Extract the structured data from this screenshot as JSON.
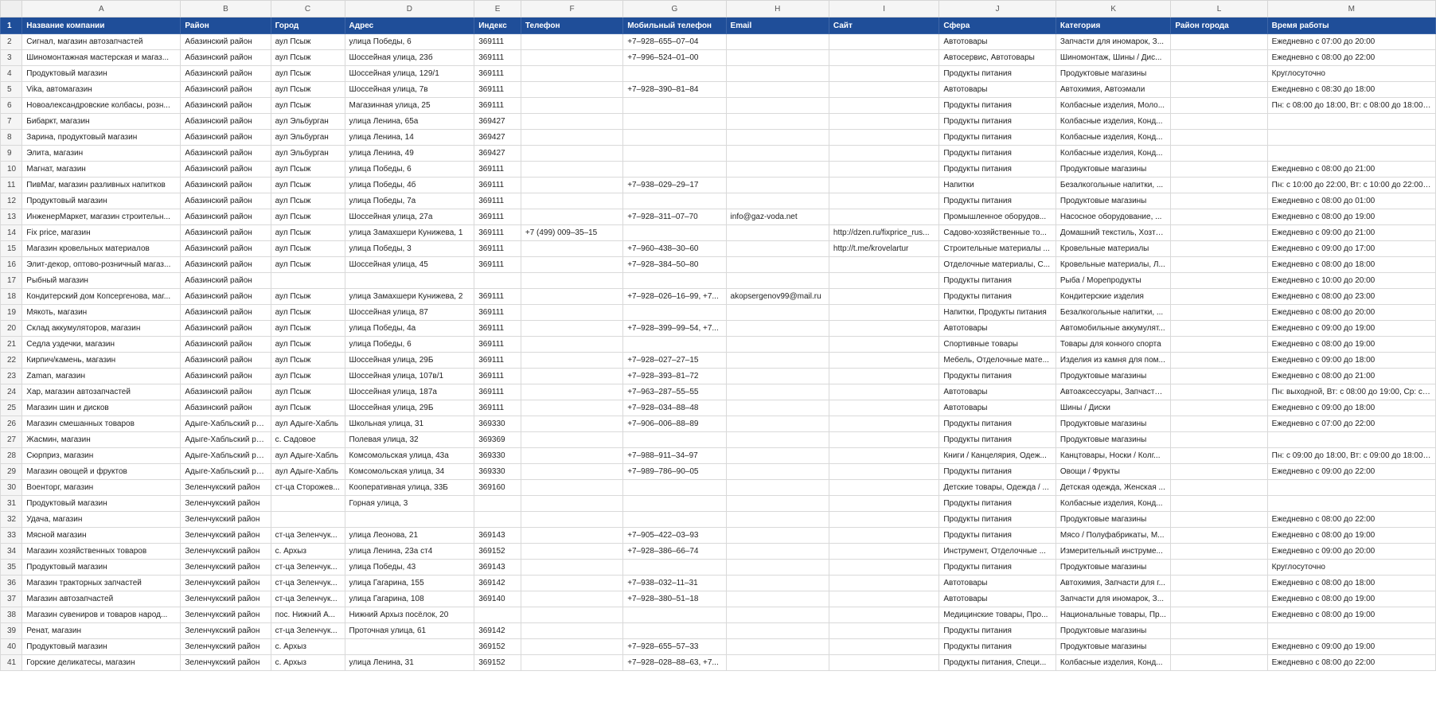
{
  "columns": [
    "A",
    "B",
    "C",
    "D",
    "E",
    "F",
    "G",
    "H",
    "I",
    "J",
    "K",
    "L",
    "M"
  ],
  "header_row_number": "1",
  "headers": [
    "Название компании",
    "Район",
    "Город",
    "Адрес",
    "Индекс",
    "Телефон",
    "Мобильный телефон",
    "Email",
    "Сайт",
    "Сфера",
    "Категория",
    "Район города",
    "Время работы"
  ],
  "rows": [
    {
      "n": "2",
      "c": [
        "Сигнал, магазин автозапчастей",
        "Абазинский район",
        "аул Псыж",
        "улица Победы, 6",
        "369111",
        "",
        "+7‒928‒655‒07‒04",
        "",
        "",
        "Автотовары",
        "Запчасти для иномарок, З...",
        "",
        "Ежедневно с 07:00 до 20:00"
      ]
    },
    {
      "n": "3",
      "c": [
        "Шиномонтажная мастерская и магаз...",
        "Абазинский район",
        "аул Псыж",
        "Шоссейная улица, 23б",
        "369111",
        "",
        "+7‒996‒524‒01‒00",
        "",
        "",
        "Автосервис, Автотовары",
        "Шиномонтаж, Шины / Дис...",
        "",
        "Ежедневно с 08:00 до 22:00"
      ]
    },
    {
      "n": "4",
      "c": [
        "Продуктовый магазин",
        "Абазинский район",
        "аул Псыж",
        "Шоссейная улица, 129/1",
        "369111",
        "",
        "",
        "",
        "",
        "Продукты питания",
        "Продуктовые магазины",
        "",
        "Круглосуточно"
      ]
    },
    {
      "n": "5",
      "c": [
        "Vika, автомагазин",
        "Абазинский район",
        "аул Псыж",
        "Шоссейная улица, 7в",
        "369111",
        "",
        "+7‒928‒390‒81‒84",
        "",
        "",
        "Автотовары",
        "Автохимия, Автоэмали",
        "",
        "Ежедневно с 08:30 до 18:00"
      ]
    },
    {
      "n": "6",
      "c": [
        "Новоалександровские колбасы, розн...",
        "Абазинский район",
        "аул Псыж",
        "Магазинная улица, 25",
        "369111",
        "",
        "",
        "",
        "",
        "Продукты питания",
        "Колбасные изделия, Моло...",
        "",
        "Пн: с 08:00 до 18:00, Вт: с 08:00 до 18:00, С..."
      ]
    },
    {
      "n": "7",
      "c": [
        "Бибаркт, магазин",
        "Абазинский район",
        "аул Эльбурган",
        "улица Ленина, 65а",
        "369427",
        "",
        "",
        "",
        "",
        "Продукты питания",
        "Колбасные изделия, Конд...",
        "",
        ""
      ]
    },
    {
      "n": "8",
      "c": [
        "Зарина, продуктовый магазин",
        "Абазинский район",
        "аул Эльбурган",
        "улица Ленина, 14",
        "369427",
        "",
        "",
        "",
        "",
        "Продукты питания",
        "Колбасные изделия, Конд...",
        "",
        ""
      ]
    },
    {
      "n": "9",
      "c": [
        "Элита, магазин",
        "Абазинский район",
        "аул Эльбурган",
        "улица Ленина, 49",
        "369427",
        "",
        "",
        "",
        "",
        "Продукты питания",
        "Колбасные изделия, Конд...",
        "",
        ""
      ]
    },
    {
      "n": "10",
      "c": [
        "Магнат, магазин",
        "Абазинский район",
        "аул Псыж",
        "улица Победы, 6",
        "369111",
        "",
        "",
        "",
        "",
        "Продукты питания",
        "Продуктовые магазины",
        "",
        "Ежедневно с 08:00 до 21:00"
      ]
    },
    {
      "n": "11",
      "c": [
        "ПивМаг, магазин разливных напитков",
        "Абазинский район",
        "аул Псыж",
        "улица Победы, 4б",
        "369111",
        "",
        "+7‒938‒029‒29‒17",
        "",
        "",
        "Напитки",
        "Безалкогольные напитки, ...",
        "",
        "Пн: с 10:00 до 22:00, Вт: с 10:00 до 22:00, С..."
      ]
    },
    {
      "n": "12",
      "c": [
        "Продуктовый магазин",
        "Абазинский район",
        "аул Псыж",
        "улица Победы, 7а",
        "369111",
        "",
        "",
        "",
        "",
        "Продукты питания",
        "Продуктовые магазины",
        "",
        "Ежедневно с 08:00 до 01:00"
      ]
    },
    {
      "n": "13",
      "c": [
        "ИнженерМаркет, магазин строительн...",
        "Абазинский район",
        "аул Псыж",
        "Шоссейная улица, 27а",
        "369111",
        "",
        "+7‒928‒311‒07‒70",
        "info@gaz-voda.net",
        "",
        "Промышленное оборудов...",
        "Насосное оборудование, ...",
        "",
        "Ежедневно с 08:00 до 19:00"
      ]
    },
    {
      "n": "14",
      "c": [
        "Fix price, магазин",
        "Абазинский район",
        "аул Псыж",
        "улица Замахшери Кунижева, 1",
        "369111",
        "+7 (499) 009‒35‒15",
        "",
        "",
        "http://dzen.ru/fixprice_rus...",
        "Садово-хозяйственные то...",
        "Домашний текстиль, Хозто...",
        "",
        "Ежедневно с 09:00 до 21:00"
      ]
    },
    {
      "n": "15",
      "c": [
        "Магазин кровельных материалов",
        "Абазинский район",
        "аул Псыж",
        "улица Победы, 3",
        "369111",
        "",
        "+7‒960‒438‒30‒60",
        "",
        "http://t.me/krovelartur",
        "Строительные материалы ...",
        "Кровельные материалы",
        "",
        "Ежедневно с 09:00 до 17:00"
      ]
    },
    {
      "n": "16",
      "c": [
        "Элит-декор, оптово-розничный магаз...",
        "Абазинский район",
        "аул Псыж",
        "Шоссейная улица, 45",
        "369111",
        "",
        "+7‒928‒384‒50‒80",
        "",
        "",
        "Отделочные материалы, С...",
        "Кровельные материалы, Л...",
        "",
        "Ежедневно с 08:00 до 18:00"
      ]
    },
    {
      "n": "17",
      "c": [
        "Рыбный магазин",
        "Абазинский район",
        "",
        "",
        "",
        "",
        "",
        "",
        "",
        "Продукты питания",
        "Рыба / Морепродукты",
        "",
        "Ежедневно с 10:00 до 20:00"
      ]
    },
    {
      "n": "18",
      "c": [
        "Кондитерский дом Копсергенова, маг...",
        "Абазинский район",
        "аул Псыж",
        "улица Замахшери Кунижева, 2",
        "369111",
        "",
        "+7‒928‒026‒16‒99, +7...",
        "akopsergenov99@mail.ru",
        "",
        "Продукты питания",
        "Кондитерские изделия",
        "",
        "Ежедневно с 08:00 до 23:00"
      ]
    },
    {
      "n": "19",
      "c": [
        "Мякоть, магазин",
        "Абазинский район",
        "аул Псыж",
        "Шоссейная улица, 87",
        "369111",
        "",
        "",
        "",
        "",
        "Напитки, Продукты питания",
        "Безалкогольные напитки, ...",
        "",
        "Ежедневно с 08:00 до 20:00"
      ]
    },
    {
      "n": "20",
      "c": [
        "Склад аккумуляторов, магазин",
        "Абазинский район",
        "аул Псыж",
        "улица Победы, 4а",
        "369111",
        "",
        "+7‒928‒399‒99‒54, +7...",
        "",
        "",
        "Автотовары",
        "Автомобильные аккумулят...",
        "",
        "Ежедневно с 09:00 до 19:00"
      ]
    },
    {
      "n": "21",
      "c": [
        "Седла уздечки, магазин",
        "Абазинский район",
        "аул Псыж",
        "улица Победы, 6",
        "369111",
        "",
        "",
        "",
        "",
        "Спортивные товары",
        "Товары для конного спорта",
        "",
        "Ежедневно с 08:00 до 19:00"
      ]
    },
    {
      "n": "22",
      "c": [
        "Кирпич/камень, магазин",
        "Абазинский район",
        "аул Псыж",
        "Шоссейная улица, 29Б",
        "369111",
        "",
        "+7‒928‒027‒27‒15",
        "",
        "",
        "Мебель, Отделочные мате...",
        "Изделия из камня для пом...",
        "",
        "Ежедневно с 09:00 до 18:00"
      ]
    },
    {
      "n": "23",
      "c": [
        "Zaman, магазин",
        "Абазинский район",
        "аул Псыж",
        "Шоссейная улица, 107в/1",
        "369111",
        "",
        "+7‒928‒393‒81‒72",
        "",
        "",
        "Продукты питания",
        "Продуктовые магазины",
        "",
        "Ежедневно с 08:00 до 21:00"
      ]
    },
    {
      "n": "24",
      "c": [
        "Хар, магазин автозапчастей",
        "Абазинский район",
        "аул Псыж",
        "Шоссейная улица, 187а",
        "369111",
        "",
        "+7‒963‒287‒55‒55",
        "",
        "",
        "Автотовары",
        "Автоаксессуары, Запчасти ...",
        "",
        "Пн: выходной, Вт: с 08:00 до 19:00, Ср: с 0..."
      ]
    },
    {
      "n": "25",
      "c": [
        "Магазин шин и дисков",
        "Абазинский район",
        "аул Псыж",
        "Шоссейная улица, 29Б",
        "369111",
        "",
        "+7‒928‒034‒88‒48",
        "",
        "",
        "Автотовары",
        "Шины / Диски",
        "",
        "Ежедневно с 09:00 до 18:00"
      ]
    },
    {
      "n": "26",
      "c": [
        "Магазин смешанных товаров",
        "Адыге-Хабльский район",
        "аул Адыге-Хабль",
        "Школьная улица, 31",
        "369330",
        "",
        "+7‒906‒006‒88‒89",
        "",
        "",
        "Продукты питания",
        "Продуктовые магазины",
        "",
        "Ежедневно с 07:00 до 22:00"
      ]
    },
    {
      "n": "27",
      "c": [
        "Жасмин, магазин",
        "Адыге-Хабльский район",
        "с. Садовое",
        "Полевая улица, 32",
        "369369",
        "",
        "",
        "",
        "",
        "Продукты питания",
        "Продуктовые магазины",
        "",
        ""
      ]
    },
    {
      "n": "28",
      "c": [
        "Сюрприз, магазин",
        "Адыге-Хабльский район",
        "аул Адыге-Хабль",
        "Комсомольская улица, 43а",
        "369330",
        "",
        "+7‒988‒911‒34‒97",
        "",
        "",
        "Книги / Канцелярия, Одеж...",
        "Канцтовары, Носки / Колг...",
        "",
        "Пн: с 09:00 до 18:00, Вт: с 09:00 до 18:00, С..."
      ]
    },
    {
      "n": "29",
      "c": [
        "Магазин овощей и фруктов",
        "Адыге-Хабльский район",
        "аул Адыге-Хабль",
        "Комсомольская улица, 34",
        "369330",
        "",
        "+7‒989‒786‒90‒05",
        "",
        "",
        "Продукты питания",
        "Овощи / Фрукты",
        "",
        "Ежедневно с 09:00 до 22:00"
      ]
    },
    {
      "n": "30",
      "c": [
        "Военторг, магазин",
        "Зеленчукский район",
        "ст-ца Сторожев...",
        "Кооперативная улица, 33Б",
        "369160",
        "",
        "",
        "",
        "",
        "Детские товары, Одежда / ...",
        "Детская одежда, Женская ...",
        "",
        ""
      ]
    },
    {
      "n": "31",
      "c": [
        "Продуктовый магазин",
        "Зеленчукский район",
        "",
        "Горная улица, 3",
        "",
        "",
        "",
        "",
        "",
        "Продукты питания",
        "Колбасные изделия, Конд...",
        "",
        ""
      ]
    },
    {
      "n": "32",
      "c": [
        "Удача, магазин",
        "Зеленчукский район",
        "",
        "",
        "",
        "",
        "",
        "",
        "",
        "Продукты питания",
        "Продуктовые магазины",
        "",
        "Ежедневно с 08:00 до 22:00"
      ]
    },
    {
      "n": "33",
      "c": [
        "Мясной магазин",
        "Зеленчукский район",
        "ст-ца Зеленчук...",
        "улица Леонова, 21",
        "369143",
        "",
        "+7‒905‒422‒03‒93",
        "",
        "",
        "Продукты питания",
        "Мясо / Полуфабрикаты, М...",
        "",
        "Ежедневно с 08:00 до 19:00"
      ]
    },
    {
      "n": "34",
      "c": [
        "Магазин хозяйственных товаров",
        "Зеленчукский район",
        "с. Архыз",
        "улица Ленина, 23а ст4",
        "369152",
        "",
        "+7‒928‒386‒66‒74",
        "",
        "",
        "Инструмент, Отделочные ...",
        "Измерительный инструме...",
        "",
        "Ежедневно с 09:00 до 20:00"
      ]
    },
    {
      "n": "35",
      "c": [
        "Продуктовый магазин",
        "Зеленчукский район",
        "ст-ца Зеленчук...",
        "улица Победы, 43",
        "369143",
        "",
        "",
        "",
        "",
        "Продукты питания",
        "Продуктовые магазины",
        "",
        "Круглосуточно"
      ]
    },
    {
      "n": "36",
      "c": [
        "Магазин тракторных запчастей",
        "Зеленчукский район",
        "ст-ца Зеленчук...",
        "улица Гагарина, 155",
        "369142",
        "",
        "+7‒938‒032‒11‒31",
        "",
        "",
        "Автотовары",
        "Автохимия, Запчасти для г...",
        "",
        "Ежедневно с 08:00 до 18:00"
      ]
    },
    {
      "n": "37",
      "c": [
        "Магазин автозапчастей",
        "Зеленчукский район",
        "ст-ца Зеленчук...",
        "улица Гагарина, 108",
        "369140",
        "",
        "+7‒928‒380‒51‒18",
        "",
        "",
        "Автотовары",
        "Запчасти для иномарок, З...",
        "",
        "Ежедневно с 08:00 до 19:00"
      ]
    },
    {
      "n": "38",
      "c": [
        "Магазин сувениров и товаров народ...",
        "Зеленчукский район",
        "пос. Нижний А...",
        "Нижний Архыз посёлок, 20",
        "",
        "",
        "",
        "",
        "",
        "Медицинские товары, Про...",
        "Национальные товары, Пр...",
        "",
        "Ежедневно с 08:00 до 19:00"
      ]
    },
    {
      "n": "39",
      "c": [
        "Ренат, магазин",
        "Зеленчукский район",
        "ст-ца Зеленчук...",
        "Проточная улица, 61",
        "369142",
        "",
        "",
        "",
        "",
        "Продукты питания",
        "Продуктовые магазины",
        "",
        ""
      ]
    },
    {
      "n": "40",
      "c": [
        "Продуктовый магазин",
        "Зеленчукский район",
        "с. Архыз",
        "",
        "369152",
        "",
        "+7‒928‒655‒57‒33",
        "",
        "",
        "Продукты питания",
        "Продуктовые магазины",
        "",
        "Ежедневно с 09:00 до 19:00"
      ]
    },
    {
      "n": "41",
      "c": [
        "Горские деликатесы, магазин",
        "Зеленчукский район",
        "с. Архыз",
        "улица Ленина, 31",
        "369152",
        "",
        "+7‒928‒028‒88‒63, +7...",
        "",
        "",
        "Продукты питания, Специ...",
        "Колбасные изделия, Конд...",
        "",
        "Ежедневно с 08:00 до 22:00"
      ]
    }
  ]
}
